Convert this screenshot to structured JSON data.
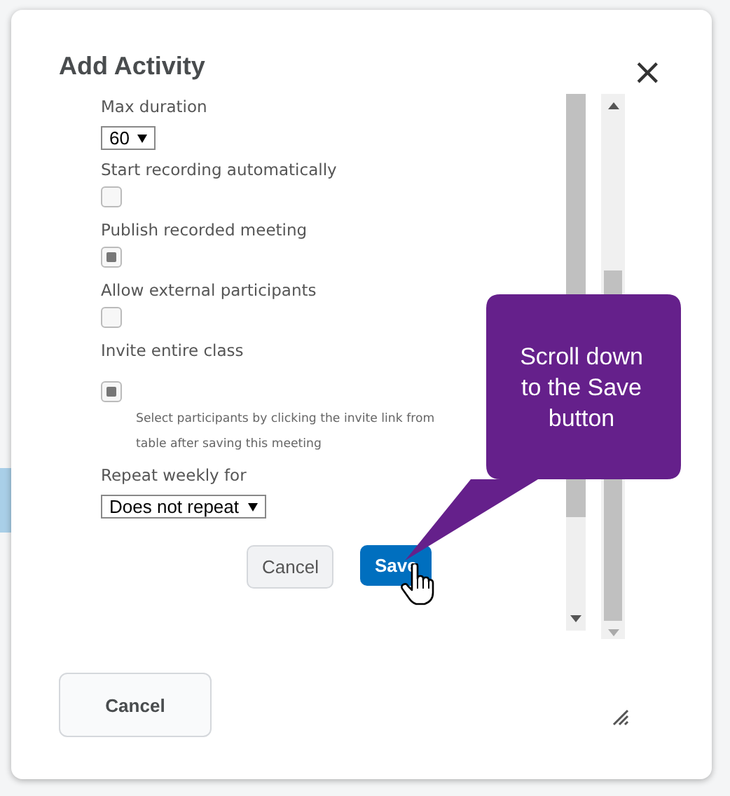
{
  "dialog": {
    "title": "Add Activity",
    "close": "×",
    "fields": [
      {
        "kind": "select",
        "label": "Max duration",
        "value": "60"
      },
      {
        "kind": "checkbox",
        "label": "Start recording automatically",
        "checked": false
      },
      {
        "kind": "checkbox",
        "label": "Publish recorded meeting",
        "checked": true
      },
      {
        "kind": "checkbox",
        "label": "Allow external participants",
        "checked": false
      },
      {
        "kind": "checkbox",
        "label": "Invite entire class",
        "checked": true,
        "note": "Select participants by clicking the invite link from\ntable after saving this meeting"
      },
      {
        "kind": "select",
        "label": "Repeat weekly for",
        "value": "Does not repeat"
      }
    ],
    "buttons": [
      {
        "label": "Cancel",
        "primary": false
      },
      {
        "label": "Save",
        "primary": true
      }
    ],
    "footer_button": "Cancel"
  },
  "callout": {
    "text": "Scroll down to the Save button"
  }
}
